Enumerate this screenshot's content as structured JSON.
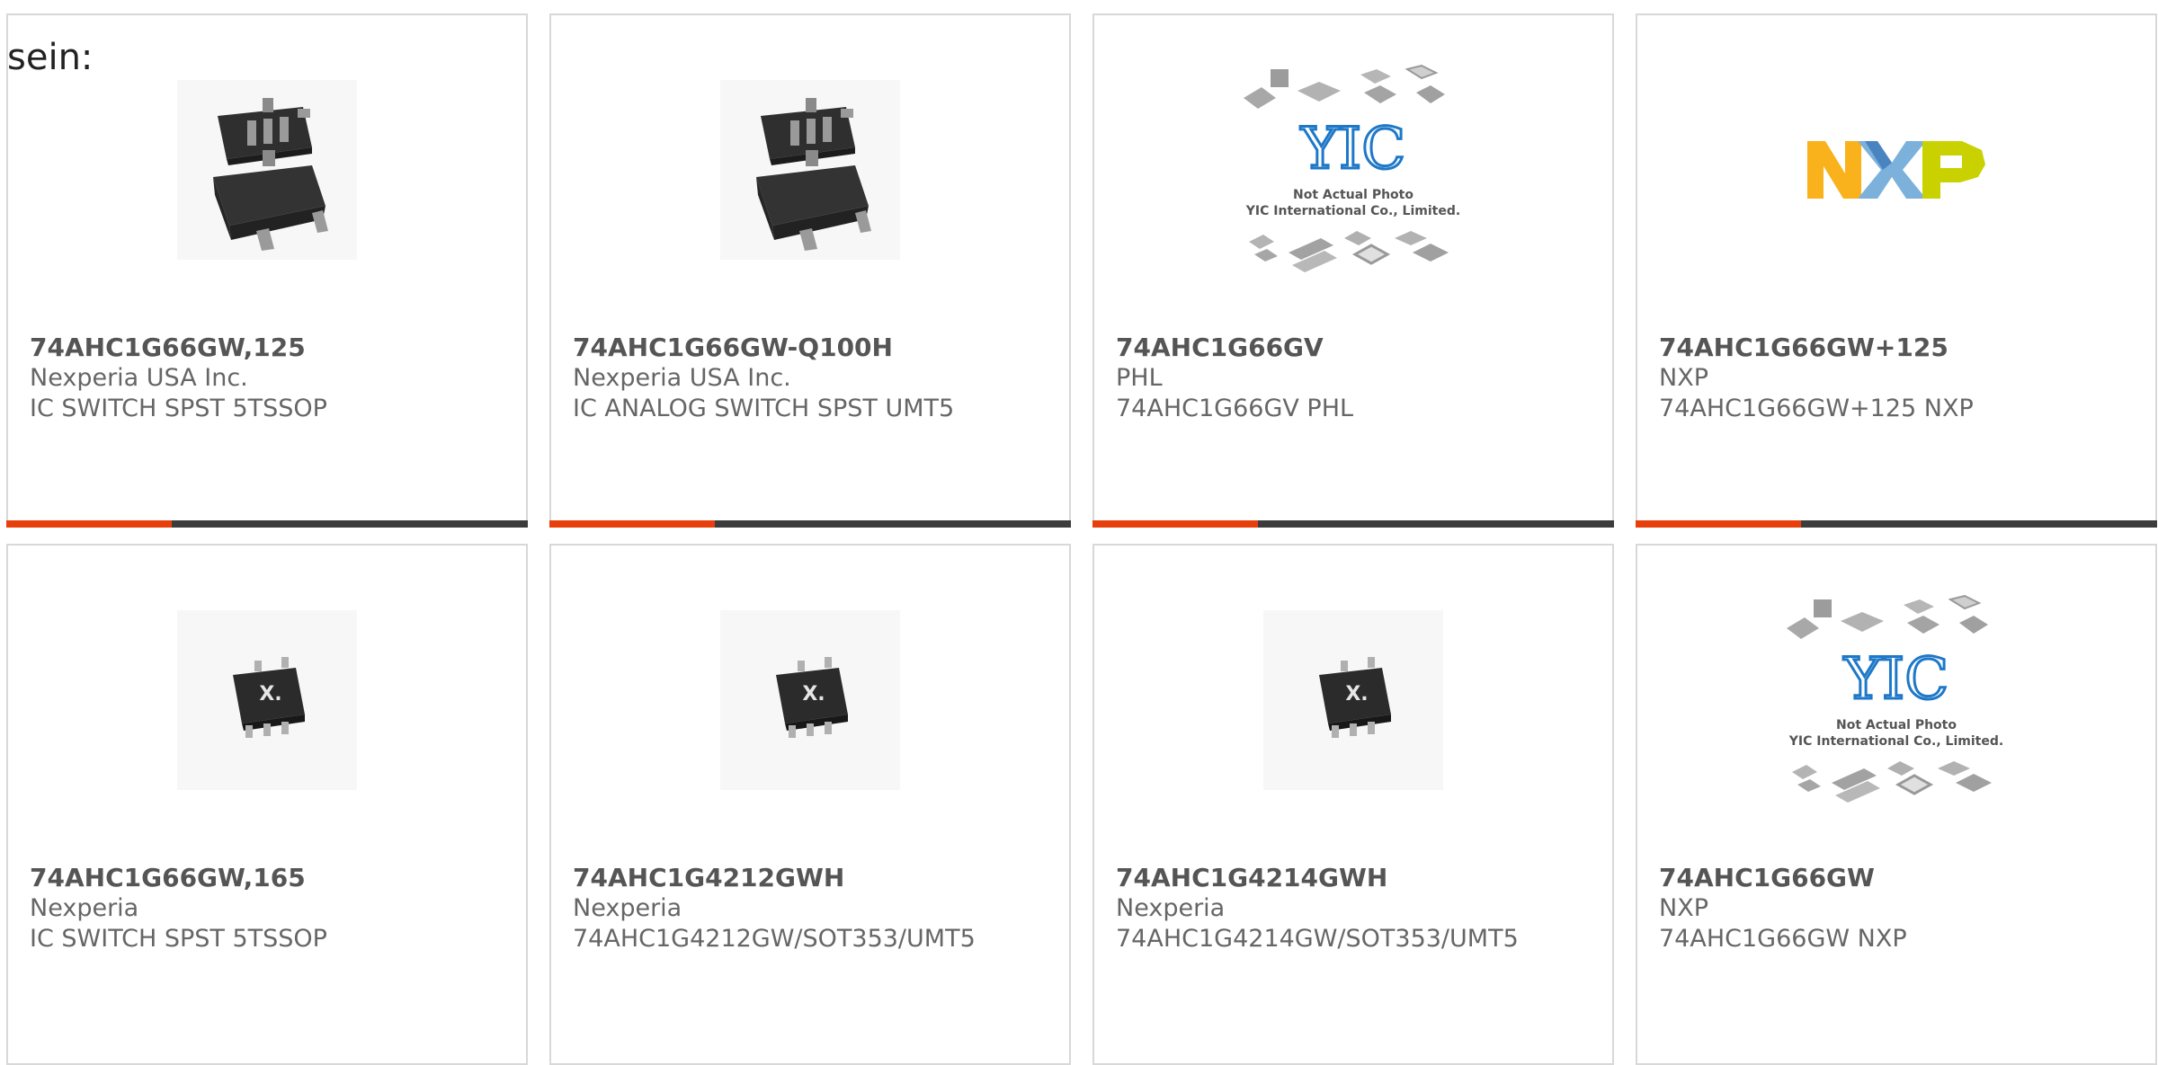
{
  "heading": "sein:",
  "accent_color": "#e8400c",
  "bar_color": "#3c3c3c",
  "products": [
    {
      "part": "74AHC1G66GW,125",
      "manufacturer": "Nexperia USA Inc.",
      "description": "IC SWITCH SPST 5TSSOP",
      "image": "sot-package-photo"
    },
    {
      "part": "74AHC1G66GW-Q100H",
      "manufacturer": "Nexperia USA Inc.",
      "description": "IC ANALOG SWITCH SPST UMT5",
      "image": "sot-package-photo"
    },
    {
      "part": "74AHC1G66GV",
      "manufacturer": "PHL",
      "description": "74AHC1G66GV PHL",
      "image": "yic-placeholder",
      "placeholder_line1": "Not Actual Photo",
      "placeholder_line2": "YIC International Co., Limited."
    },
    {
      "part": "74AHC1G66GW+125",
      "manufacturer": "NXP",
      "description": "74AHC1G66GW+125 NXP",
      "image": "nxp-logo"
    },
    {
      "part": "74AHC1G66GW,165",
      "manufacturer": "Nexperia",
      "description": "IC SWITCH SPST 5TSSOP",
      "image": "nexperia-chip-photo"
    },
    {
      "part": "74AHC1G4212GWH",
      "manufacturer": "Nexperia",
      "description": "74AHC1G4212GW/SOT353/UMT5",
      "image": "nexperia-chip-photo"
    },
    {
      "part": "74AHC1G4214GWH",
      "manufacturer": "Nexperia",
      "description": "74AHC1G4214GW/SOT353/UMT5",
      "image": "nexperia-chip-photo"
    },
    {
      "part": "74AHC1G66GW",
      "manufacturer": "NXP",
      "description": "74AHC1G66GW NXP",
      "image": "yic-placeholder",
      "placeholder_line1": "Not Actual Photo",
      "placeholder_line2": "YIC International Co., Limited."
    }
  ]
}
